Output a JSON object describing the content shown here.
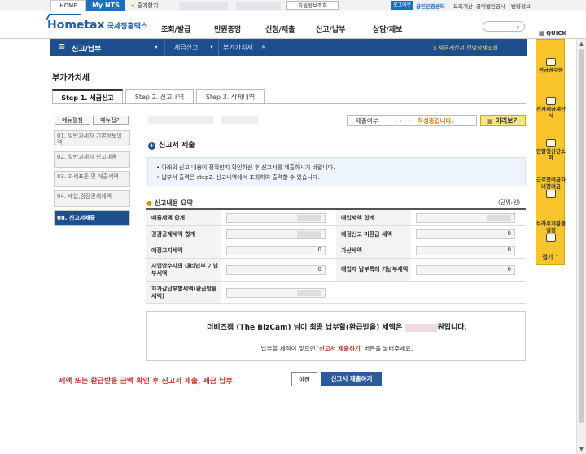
{
  "topbar": {
    "home": "HOME",
    "mynts": "My NTS",
    "favorites": "즐겨찾기",
    "member": "회원정보조회",
    "logout": "로그아웃",
    "links": [
      "공인인증센터",
      "모의계산",
      "공익법인공시",
      "범령정보"
    ]
  },
  "header": {
    "logo": "Hometax",
    "logo_kr": "국세청홈택스",
    "nav": [
      "조회/발급",
      "민원증명",
      "신청/제출",
      "신고/납부",
      "상담/제보"
    ],
    "quick": "QUICK"
  },
  "bluebar": {
    "menu_label": "신고/납부",
    "crumb1": "세금신고",
    "crumb2": "부가가치세",
    "notice": "5  세금계산서 건별상세조회"
  },
  "rightside": {
    "items": [
      "현금영수증",
      "전자세금계산서",
      "연말정산간소화",
      "근로장려금자녀장려금",
      "브라우저환경설정"
    ],
    "fold": "접기"
  },
  "page": {
    "title": "부가가치세",
    "tabs": [
      "Step 1. 세금신고",
      "Step 2. 신고내역",
      "Step 3. 삭제내역"
    ],
    "side_open": "메뉴펼침",
    "side_close": "메뉴접기",
    "side_menu": [
      "01. 일반과세자 기본정보입력",
      "02. 일반과세자 신고내용",
      "03. 과세표준 및 매출세액",
      "04. 매입,경감공제세액",
      "08. 신고서제출"
    ],
    "status_label": "제출여부",
    "status_arrows": "› › › ›",
    "status_value": "작성중입니다.",
    "preview": "미리보기",
    "section_title": "신고서 제출",
    "info_lines": [
      "• 아래의 신고 내용이 정확한지 확인하신 후 신고서를 제출하시기 바랍니다.",
      "• 납부서 출력은 step2. 신고내역에서 조회하여 출력할 수 있습니다."
    ],
    "summary_title": "신고내용 요약",
    "unit": "(단위:원)",
    "rows": [
      {
        "l": "매출세액 합계",
        "lv": "",
        "r": "매입세액 합계",
        "rv": ""
      },
      {
        "l": "경감공제세액 합계",
        "lv": "",
        "r": "예정신고 미환급 세액",
        "rv": "0"
      },
      {
        "l": "예정고지세액",
        "lv": "0",
        "r": "가산세액",
        "rv": "0"
      },
      {
        "l": "사업양수자의 대리납부 기납부세액",
        "lv": "0",
        "r": "매입자 납부특례 기납부세액",
        "rv": "0"
      },
      {
        "l": "차가감납부할세액(환급받을세액)",
        "lv": "",
        "r": "",
        "rv": ""
      }
    ],
    "result_line1_a": "더비즈캠 (The BizCam) 님이 최종 납부할(환급받을) 세액은",
    "result_line1_b": "원입니다.",
    "result_line2_a": "납부할 세액이 맞으면 '",
    "result_line2_em": "신고서 제출하기",
    "result_line2_b": "' 버튼을 눌러주세요.",
    "caption": "세액 또는 환급받을 금액 확인 후 신고서 제출, 세금 납부",
    "prev": "이전",
    "submit": "신고서 제출하기"
  }
}
